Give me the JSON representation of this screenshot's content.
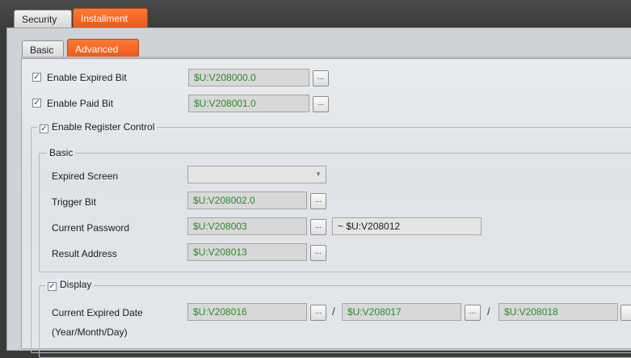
{
  "outer_tabs": [
    "Security",
    "Installment"
  ],
  "inner_tabs": [
    "Basic",
    "Advanced"
  ],
  "expired_bit": {
    "label": "Enable Expired Bit",
    "value": "$U:V208000.0"
  },
  "paid_bit": {
    "label": "Enable Paid Bit",
    "value": "$U:V208001.0"
  },
  "register_control": {
    "label": "Enable Register Control"
  },
  "basic_group": {
    "legend": "Basic",
    "expired_screen": {
      "label": "Expired Screen",
      "value": ""
    },
    "trigger_bit": {
      "label": "Trigger Bit",
      "value": "$U:V208002.0"
    },
    "current_password": {
      "label": "Current Password",
      "value": "$U:V208003",
      "range_end": "~ $U:V208012"
    },
    "result_address": {
      "label": "Result Address",
      "value": "$U:V208013"
    }
  },
  "display_group": {
    "legend": "Display",
    "current_expired_date": {
      "label": "Current Expired Date",
      "sublabel": "(Year/Month/Day)",
      "year": "$U:V208016",
      "month": "$U:V208017",
      "day": "$U:V208018",
      "separator": "/"
    }
  },
  "browse_glyph": "...",
  "colors": {
    "active_tab": "#F26522",
    "address_text": "#2A8A2A"
  }
}
